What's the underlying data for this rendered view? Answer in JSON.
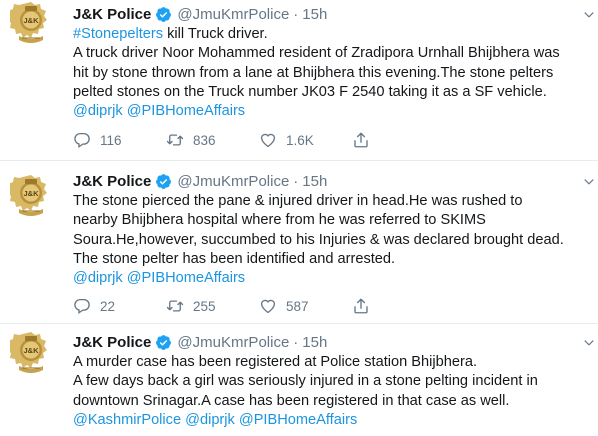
{
  "tweets": [
    {
      "author": "J&K Police",
      "handle": "@JmuKmrPolice",
      "separator": "·",
      "time": "15h",
      "hashtag": "#Stonepelters",
      "line1_rest": " kill Truck driver.",
      "text": " A truck driver Noor Mohammed resident of Zradipora Urnhall Bhijbhera was\nhit by stone thrown from a lane at Bhijbhera this evening.The stone pelters\npelted stones on the Truck number JK03 F 2540 taking it as a SF vehicle.",
      "mentions": "@diprjk @PIBHomeAffairs",
      "replies": "116",
      "retweets": "836",
      "likes": "1.6K"
    },
    {
      "author": "J&K Police",
      "handle": "@JmuKmrPolice",
      "separator": "·",
      "time": "15h",
      "text": "The stone pierced the pane & injured driver in head.He was rushed to\nnearby Bhijbhera hospital where from he was referred to SKIMS\nSoura.He,however, succumbed to his Injuries & was declared brought dead.\nThe stone pelter has been identified and arrested.",
      "mentions": "@diprjk @PIBHomeAffairs",
      "replies": "22",
      "retweets": "255",
      "likes": "587"
    },
    {
      "author": "J&K Police",
      "handle": "@JmuKmrPolice",
      "separator": "·",
      "time": "15h",
      "text": "A murder case has been registered  at Police station Bhijbhera.\nA few days back a girl was seriously injured in a stone pelting incident in\ndowntown Srinagar.A case has been registered in that case as well.",
      "mentions": "@KashmirPolice @diprjk @PIBHomeAffairs"
    }
  ],
  "icons": {
    "avatar": "jk-police-emblem-icon",
    "verified": "verified-badge-icon",
    "caret": "chevron-down-icon",
    "reply": "reply-icon",
    "retweet": "retweet-icon",
    "like": "heart-icon",
    "share": "share-icon"
  },
  "colors": {
    "link": "#1b95e0",
    "secondary_text": "#657786",
    "verified": "#1da1f2",
    "emblem": "#c8a24a"
  }
}
